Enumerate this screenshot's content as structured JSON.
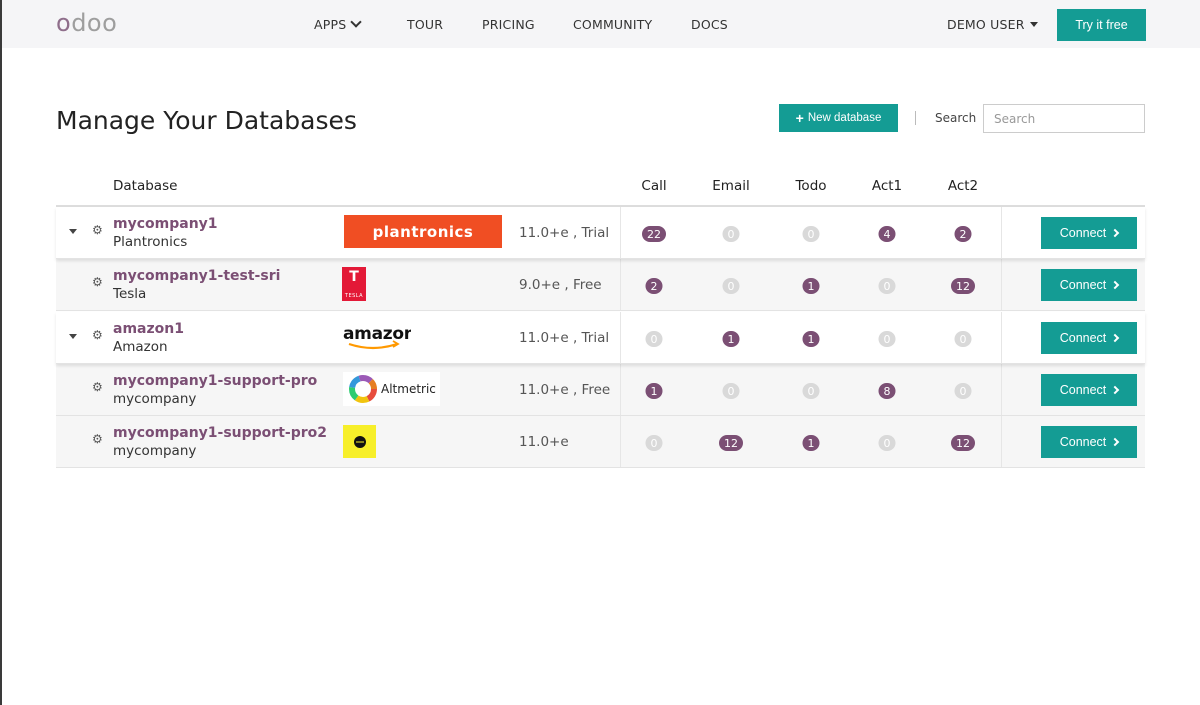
{
  "nav": {
    "logo": "odoo",
    "items": [
      "APPS",
      "TOUR",
      "PRICING",
      "COMMUNITY",
      "DOCS"
    ],
    "user": "DEMO USER",
    "try_label": "Try it free"
  },
  "header": {
    "title": "Manage Your Databases",
    "new_db_label": "New database",
    "search_label": "Search",
    "search_placeholder": "Search"
  },
  "table": {
    "columns": {
      "database": "Database",
      "call": "Call",
      "email": "Email",
      "todo": "Todo",
      "act1": "Act1",
      "act2": "Act2"
    },
    "connect_label": "Connect",
    "rows": [
      {
        "name": "mycompany1",
        "company": "Plantronics",
        "logo": "plantronics",
        "version": "11.0+e , Trial",
        "call": "22",
        "email": "0",
        "todo": "0",
        "act1": "4",
        "act2": "2"
      },
      {
        "name": "mycompany1-test-sri",
        "company": "Tesla",
        "logo": "TESLA",
        "version": "9.0+e , Free",
        "call": "2",
        "email": "0",
        "todo": "1",
        "act1": "0",
        "act2": "12"
      },
      {
        "name": "amazon1",
        "company": "Amazon",
        "logo": "amazon",
        "version": "11.0+e , Trial",
        "call": "0",
        "email": "1",
        "todo": "1",
        "act1": "0",
        "act2": "0"
      },
      {
        "name": "mycompany1-support-pro",
        "company": "mycompany",
        "logo": "Altmetric",
        "version": "11.0+e , Free",
        "call": "1",
        "email": "0",
        "todo": "0",
        "act1": "8",
        "act2": "0"
      },
      {
        "name": "mycompany1-support-pro2",
        "company": "mycompany",
        "logo": "yellow-logo",
        "version": "11.0+e",
        "call": "0",
        "email": "12",
        "todo": "1",
        "act1": "0",
        "act2": "12"
      }
    ]
  },
  "colors": {
    "primary": "#149c94",
    "brand": "#7b4f74",
    "badge_inactive": "#d9d9d9"
  }
}
